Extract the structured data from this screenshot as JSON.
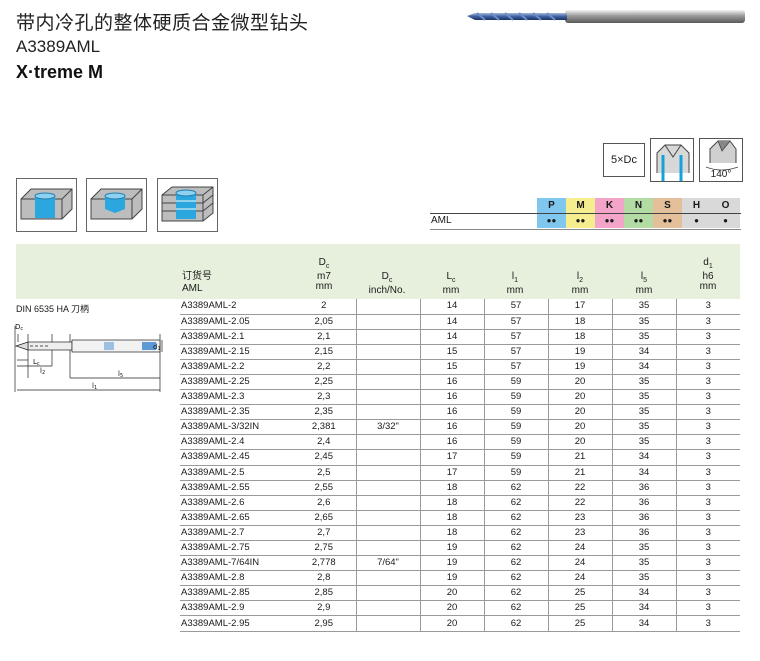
{
  "header": {
    "title_cn": "带内冷孔的整体硬质合金微型钻头",
    "code": "A3389AML",
    "brand": "X·treme M"
  },
  "features": {
    "length_label": "5×Dc",
    "point_angle": "140°"
  },
  "materials": {
    "row_label": "AML",
    "groups": [
      {
        "letter": "P",
        "color": "#7fc7ef",
        "dots": "●●"
      },
      {
        "letter": "M",
        "color": "#f6ee8e",
        "dots": "●●"
      },
      {
        "letter": "K",
        "color": "#f2a5c8",
        "dots": "●●"
      },
      {
        "letter": "N",
        "color": "#b2dca4",
        "dots": "●●"
      },
      {
        "letter": "S",
        "color": "#e3bf9a",
        "dots": "●●"
      },
      {
        "letter": "H",
        "color": "#d9d9d9",
        "dots": "●"
      },
      {
        "letter": "O",
        "color": "#d9d9d9",
        "dots": "●"
      }
    ]
  },
  "drawing": {
    "standard": "DIN 6535 HA 刀柄"
  },
  "table": {
    "headers": {
      "code_line1": "订货号",
      "code_line2": "AML",
      "dc_sym": "D",
      "dc_sub": "c",
      "dc_tol": "m7",
      "dc_unit": "mm",
      "dci_sym": "D",
      "dci_sub": "c",
      "dci_unit": "inch/No.",
      "lc_sym": "L",
      "lc_sub": "c",
      "lc_unit": "mm",
      "l1_sym": "l",
      "l1_sub": "1",
      "l1_unit": "mm",
      "l2_sym": "l",
      "l2_sub": "2",
      "l2_unit": "mm",
      "l5_sym": "l",
      "l5_sub": "5",
      "l5_unit": "mm",
      "d1_sym": "d",
      "d1_sub": "1",
      "d1_tol": "h6",
      "d1_unit": "mm"
    },
    "rows": [
      [
        "A3389AML-2",
        "2",
        "",
        "14",
        "57",
        "17",
        "35",
        "3"
      ],
      [
        "A3389AML-2.05",
        "2,05",
        "",
        "14",
        "57",
        "18",
        "35",
        "3"
      ],
      [
        "A3389AML-2.1",
        "2,1",
        "",
        "14",
        "57",
        "18",
        "35",
        "3"
      ],
      [
        "A3389AML-2.15",
        "2,15",
        "",
        "15",
        "57",
        "19",
        "34",
        "3"
      ],
      [
        "A3389AML-2.2",
        "2,2",
        "",
        "15",
        "57",
        "19",
        "34",
        "3"
      ],
      [
        "A3389AML-2.25",
        "2,25",
        "",
        "16",
        "59",
        "20",
        "35",
        "3"
      ],
      [
        "A3389AML-2.3",
        "2,3",
        "",
        "16",
        "59",
        "20",
        "35",
        "3"
      ],
      [
        "A3389AML-2.35",
        "2,35",
        "",
        "16",
        "59",
        "20",
        "35",
        "3"
      ],
      [
        "A3389AML-3/32IN",
        "2,381",
        "3/32\"",
        "16",
        "59",
        "20",
        "35",
        "3"
      ],
      [
        "A3389AML-2.4",
        "2,4",
        "",
        "16",
        "59",
        "20",
        "35",
        "3"
      ],
      [
        "A3389AML-2.45",
        "2,45",
        "",
        "17",
        "59",
        "21",
        "34",
        "3"
      ],
      [
        "A3389AML-2.5",
        "2,5",
        "",
        "17",
        "59",
        "21",
        "34",
        "3"
      ],
      [
        "A3389AML-2.55",
        "2,55",
        "",
        "18",
        "62",
        "22",
        "36",
        "3"
      ],
      [
        "A3389AML-2.6",
        "2,6",
        "",
        "18",
        "62",
        "22",
        "36",
        "3"
      ],
      [
        "A3389AML-2.65",
        "2,65",
        "",
        "18",
        "62",
        "23",
        "36",
        "3"
      ],
      [
        "A3389AML-2.7",
        "2,7",
        "",
        "18",
        "62",
        "23",
        "36",
        "3"
      ],
      [
        "A3389AML-2.75",
        "2,75",
        "",
        "19",
        "62",
        "24",
        "35",
        "3"
      ],
      [
        "A3389AML-7/64IN",
        "2,778",
        "7/64\"",
        "19",
        "62",
        "24",
        "35",
        "3"
      ],
      [
        "A3389AML-2.8",
        "2,8",
        "",
        "19",
        "62",
        "24",
        "35",
        "3"
      ],
      [
        "A3389AML-2.85",
        "2,85",
        "",
        "20",
        "62",
        "25",
        "34",
        "3"
      ],
      [
        "A3389AML-2.9",
        "2,9",
        "",
        "20",
        "62",
        "25",
        "34",
        "3"
      ],
      [
        "A3389AML-2.95",
        "2,95",
        "",
        "20",
        "62",
        "25",
        "34",
        "3"
      ]
    ]
  }
}
